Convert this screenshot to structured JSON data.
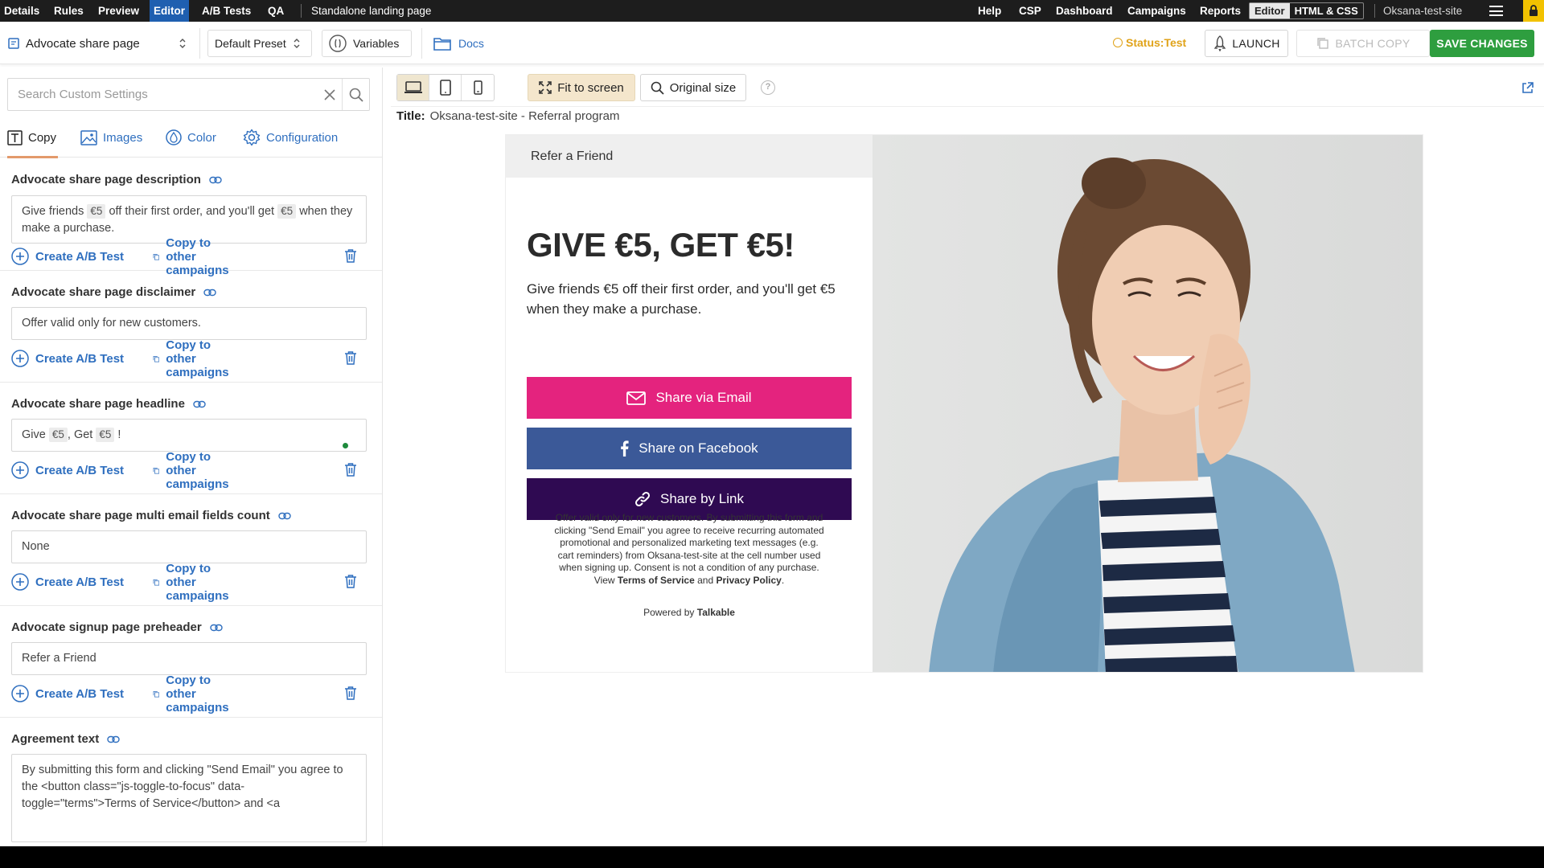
{
  "topnav": {
    "left_items": [
      "Details",
      "Rules",
      "Preview",
      "Editor",
      "A/B Tests",
      "QA"
    ],
    "active": "Editor",
    "breadcrumb": "Standalone landing page",
    "right_items": [
      "Help",
      "CSP",
      "Dashboard",
      "Campaigns",
      "Reports"
    ],
    "mode_editor": "Editor",
    "mode_htmlcss": "HTML & CSS",
    "site": "Oksana-test-site"
  },
  "toolbar": {
    "page_select": "Advocate share page",
    "preset_select": "Default Preset",
    "variables": "Variables",
    "docs": "Docs",
    "status": "Status:Test",
    "launch": "LAUNCH",
    "batch_copy": "BATCH COPY",
    "save": "SAVE CHANGES"
  },
  "left": {
    "search_placeholder": "Search Custom Settings",
    "tabs": [
      "Copy",
      "Images",
      "Color",
      "Configuration"
    ],
    "active_tab": "Copy",
    "create_ab": "Create A/B Test",
    "copy_other": "Copy to other campaigns",
    "fields": [
      {
        "label": "Advocate share page description",
        "text1": "Give friends",
        "tok1": "€5",
        "text2": "off their first order, and you'll get",
        "tok2": "€5",
        "text3": "when they make a purchase."
      },
      {
        "label": "Advocate share page disclaimer",
        "value": "Offer valid only for new customers."
      },
      {
        "label": "Advocate share page headline",
        "text1": "Give",
        "tok1": "€5",
        "text2": ", Get",
        "tok2": "€5",
        "text3": "!"
      },
      {
        "label": "Advocate share page multi email fields count",
        "value": "None"
      },
      {
        "label": "Advocate signup page preheader",
        "value": "Refer a Friend"
      },
      {
        "label": "Agreement text",
        "value": "By submitting this form and clicking \"Send Email\" you agree to the <button class=\"js-toggle-to-focus\" data-toggle=\"terms\">Terms of Service</button> and <a"
      }
    ]
  },
  "preview": {
    "fit": "Fit to screen",
    "original": "Original size",
    "help": "?",
    "title_label": "Title:",
    "title_value": "Oksana-test-site - Referral program",
    "preheader": "Refer a Friend",
    "headline": "GIVE €5, GET €5!",
    "description": "Give friends €5 off their first order, and you'll get €5 when they make a purchase.",
    "btn_email": "Share via Email",
    "btn_facebook": "Share on Facebook",
    "btn_link": "Share by Link",
    "legal_main": "Offer valid only for new customers. By submitting this form and clicking \"Send Email\" you agree to receive recurring automated promotional and personalized marketing text messages (e.g. cart reminders) from Oksana-test-site at the cell number used when signing up. Consent is not a condition of any purchase.",
    "legal_view": "View",
    "legal_tos": "Terms of Service",
    "legal_and": "and",
    "legal_pp": "Privacy Policy",
    "powered_by": "Powered by",
    "powered_brand": "Talkable"
  },
  "colors": {
    "email_btn": "#e4237e",
    "facebook_btn": "#3b5998",
    "link_btn": "#2f0a52",
    "save_btn": "#2e9e3f",
    "accent_blue": "#2f6fbf",
    "status": "#e0a31a"
  }
}
